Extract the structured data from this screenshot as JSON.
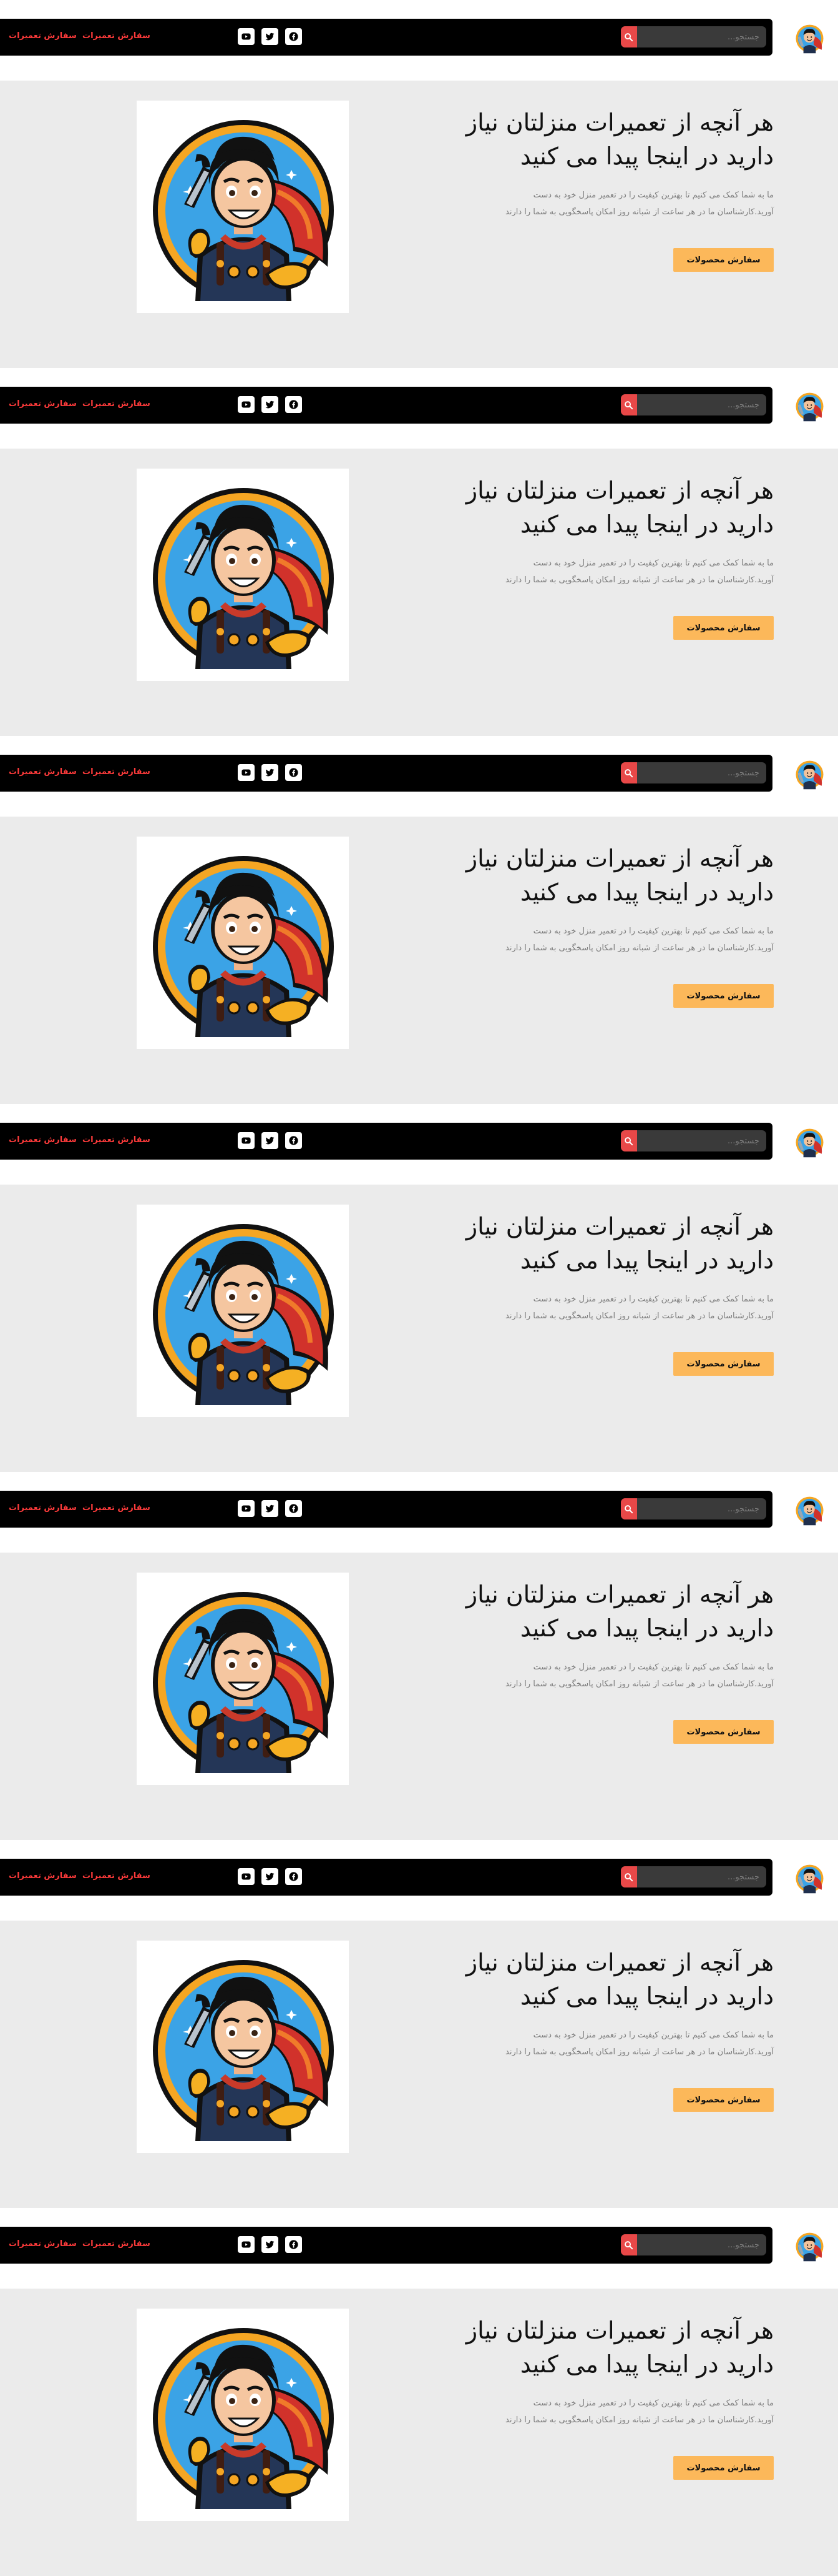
{
  "nav": {
    "links": [
      "سفارش تعمیرات",
      "سفارش تعمیرات"
    ],
    "search_placeholder": "جستجو...",
    "social_icons": [
      "facebook-icon",
      "twitter-icon",
      "youtube-icon"
    ]
  },
  "hero": {
    "title_line1": "هر آنچه از تعمیرات منزلتان نیاز",
    "title_line2": "دارید در اینجا پیدا می کنید",
    "description_line1": "ما به شما کمک می کنیم تا بهترین کیفیت را در تعمیر منزل خود به دست",
    "description_line2": "آورید.کارشناسان ما در هر ساعت از شبانه روز امکان پاسخگویی به شما را دارند",
    "button_label": "سفارش محصولات"
  },
  "colors": {
    "navbar_bg": "#000000",
    "nav_link": "#ff3b3b",
    "search_button": "#e84848",
    "hero_bg": "#ebebeb",
    "cta_bg": "#fcb85a"
  }
}
